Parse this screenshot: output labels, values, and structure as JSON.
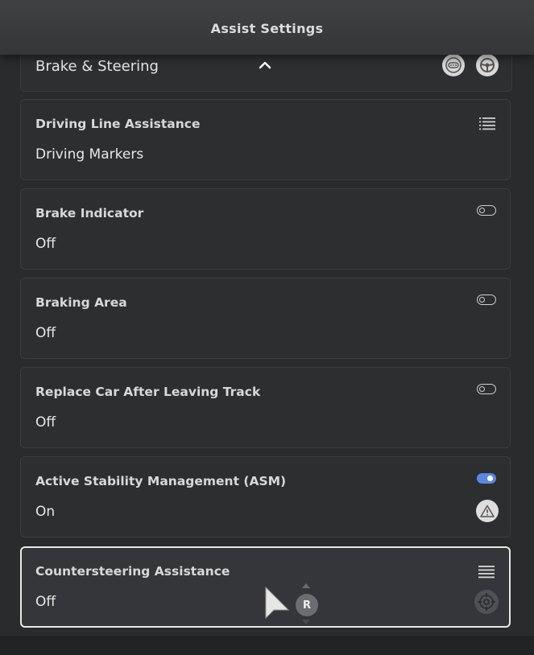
{
  "header": {
    "title": "Assist Settings"
  },
  "section": {
    "label": "Brake & Steering",
    "icons": [
      "controller-icon",
      "steering-wheel-icon"
    ]
  },
  "cards": [
    {
      "title": "Driving Line Assistance",
      "value": "Driving Markers",
      "control": "list-icon"
    },
    {
      "title": "Brake Indicator",
      "value": "Off",
      "control": "toggle-off"
    },
    {
      "title": "Braking Area",
      "value": "Off",
      "control": "toggle-off"
    },
    {
      "title": "Replace Car After Leaving Track",
      "value": "Off",
      "control": "toggle-off"
    },
    {
      "title": "Active Stability Management (ASM)",
      "value": "On",
      "control": "toggle-on",
      "extra_icon": "warning-icon"
    },
    {
      "title": "Countersteering Assistance",
      "value": "Off",
      "control": "list-icon",
      "extra_icon": "target-icon",
      "selected": true
    }
  ],
  "overlay": {
    "button_label": "R"
  },
  "colors": {
    "accent": "#5b87e0",
    "background": "#2a2b2d",
    "card": "#2d2e30"
  }
}
